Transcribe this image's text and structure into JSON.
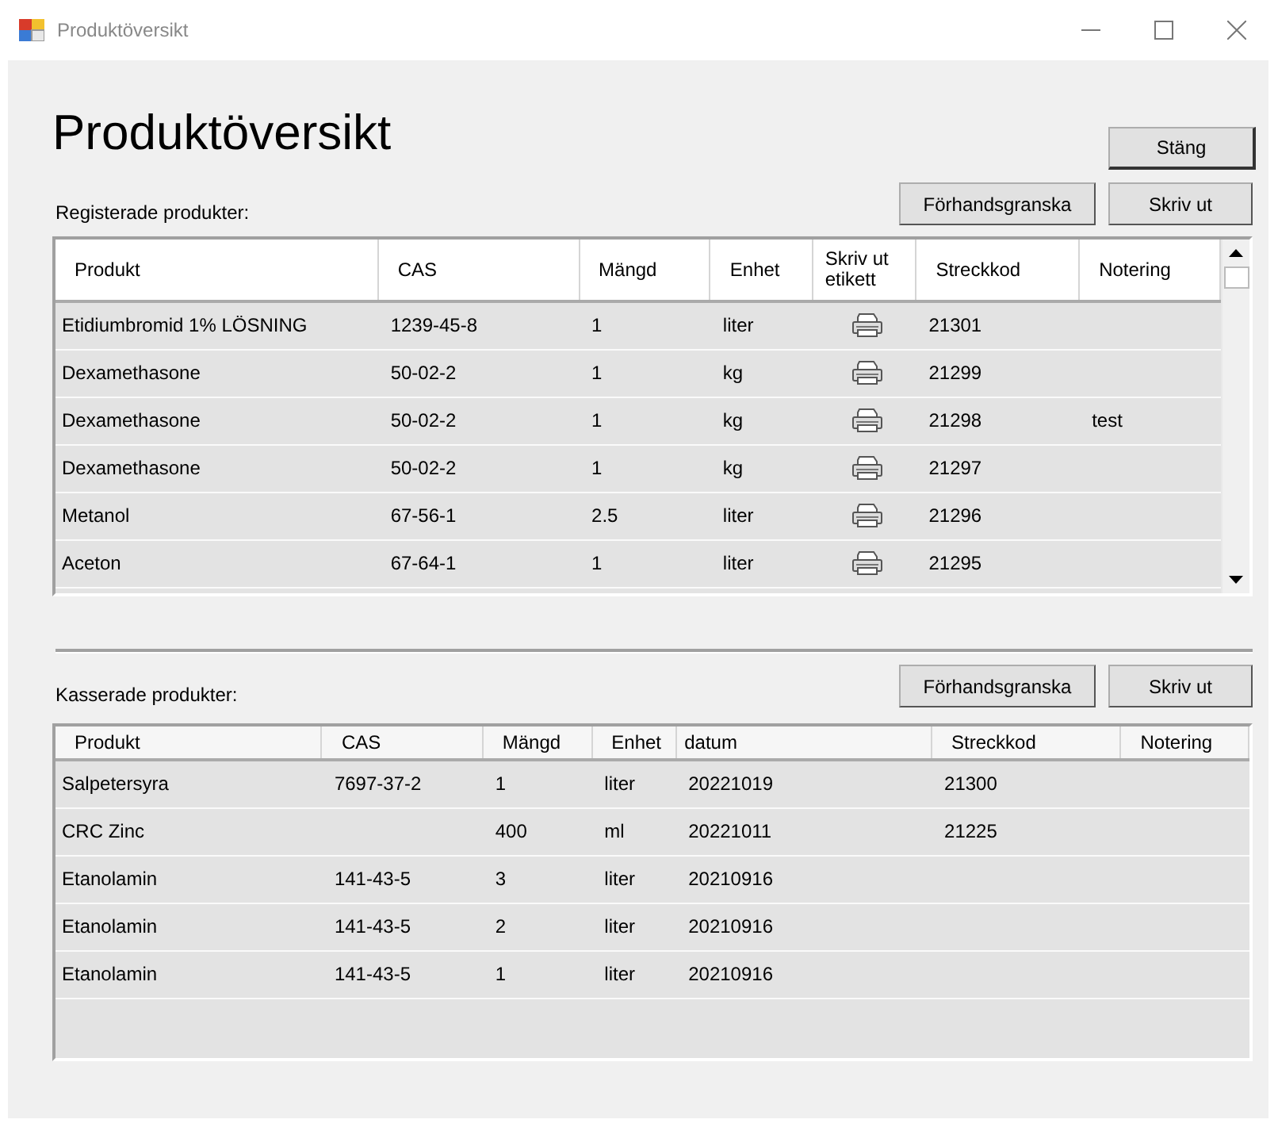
{
  "window": {
    "title": "Produktöversikt"
  },
  "heading": "Produktöversikt",
  "close_button": "Stäng",
  "registered": {
    "label": "Registerade produkter:",
    "buttons": [
      "Förhandsgranska",
      "Skriv ut"
    ],
    "columns": [
      {
        "label": "Produkt",
        "kind": "text"
      },
      {
        "label": "CAS",
        "kind": "text"
      },
      {
        "label": "Mängd",
        "kind": "text"
      },
      {
        "label": "Enhet",
        "kind": "text"
      },
      {
        "label": "Skriv ut etikett",
        "kind": "print"
      },
      {
        "label": "Streckkod",
        "kind": "text"
      },
      {
        "label": "Notering",
        "kind": "text"
      }
    ],
    "rows": [
      {
        "cells": [
          "Etidiumbromid 1% LÖSNING",
          "1239-45-8",
          "1",
          "liter",
          null,
          "21301",
          null
        ]
      },
      {
        "cells": [
          "Dexamethasone",
          "50-02-2",
          "1",
          "kg",
          null,
          "21299",
          null
        ]
      },
      {
        "cells": [
          "Dexamethasone",
          "50-02-2",
          "1",
          "kg",
          null,
          "21298",
          "test"
        ]
      },
      {
        "cells": [
          "Dexamethasone",
          "50-02-2",
          "1",
          "kg",
          null,
          "21297",
          null
        ]
      },
      {
        "cells": [
          "Metanol",
          "67-56-1",
          "2.5",
          "liter",
          null,
          "21296",
          null
        ]
      },
      {
        "cells": [
          "Aceton",
          "67-64-1",
          "1",
          "liter",
          null,
          "21295",
          null
        ]
      }
    ]
  },
  "discarded": {
    "label": "Kasserade produkter:",
    "buttons": [
      "Förhandsgranska",
      "Skriv ut"
    ],
    "columns": [
      {
        "label": "Produkt",
        "kind": "text"
      },
      {
        "label": "CAS",
        "kind": "text"
      },
      {
        "label": "Mängd",
        "kind": "text"
      },
      {
        "label": "Enhet",
        "kind": "text"
      },
      {
        "label": "datum",
        "kind": "text"
      },
      {
        "label": "Streckkod",
        "kind": "text"
      },
      {
        "label": "Notering",
        "kind": "text"
      }
    ],
    "rows": [
      {
        "cells": [
          "Salpetersyra",
          "7697-37-2",
          "1",
          "liter",
          "20221019",
          "21300",
          null
        ]
      },
      {
        "cells": [
          "CRC Zinc",
          null,
          "400",
          "ml",
          "20221011",
          "21225",
          null
        ]
      },
      {
        "cells": [
          "Etanolamin",
          "141-43-5",
          "3",
          "liter",
          "20210916",
          null,
          null
        ]
      },
      {
        "cells": [
          "Etanolamin",
          "141-43-5",
          "2",
          "liter",
          "20210916",
          null,
          null
        ]
      },
      {
        "cells": [
          "Etanolamin",
          "141-43-5",
          "1",
          "liter",
          "20210916",
          null,
          null
        ]
      }
    ]
  }
}
